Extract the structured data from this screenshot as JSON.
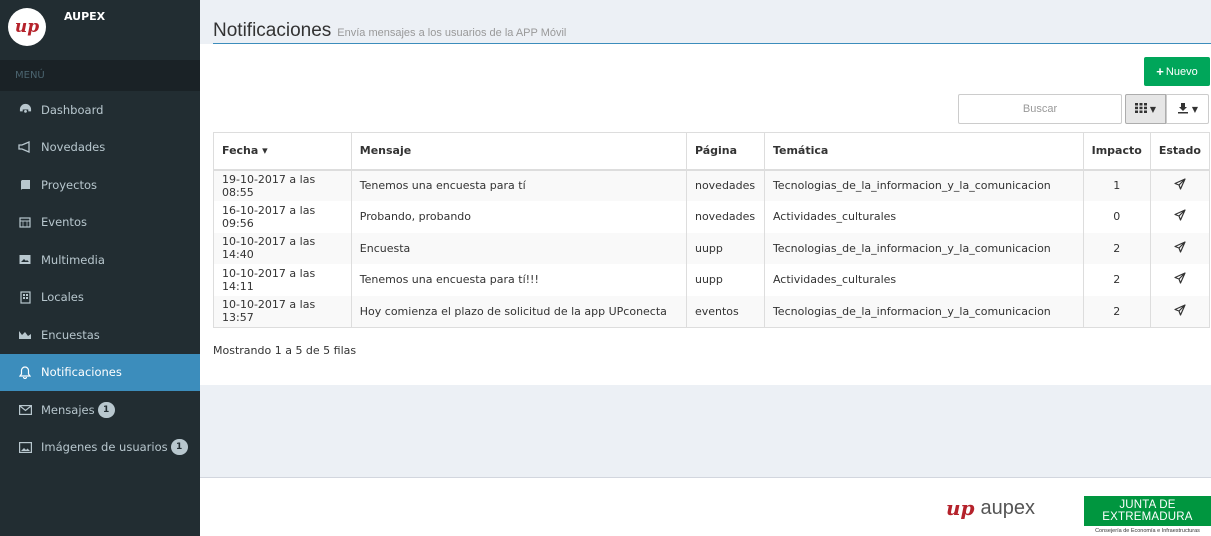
{
  "sidebar": {
    "brand": "AUPEX",
    "logo_text": "up",
    "menu_header": "MENÚ",
    "items": [
      {
        "label": "Dashboard",
        "icon": "dashboard-icon"
      },
      {
        "label": "Novedades",
        "icon": "bullhorn-icon"
      },
      {
        "label": "Proyectos",
        "icon": "book-icon"
      },
      {
        "label": "Eventos",
        "icon": "calendar-icon"
      },
      {
        "label": "Multimedia",
        "icon": "photo-icon"
      },
      {
        "label": "Locales",
        "icon": "building-icon"
      },
      {
        "label": "Encuestas",
        "icon": "chart-icon"
      },
      {
        "label": "Notificaciones",
        "icon": "bell-icon",
        "active": true
      },
      {
        "label": "Mensajes",
        "icon": "envelope-icon",
        "badge": "1"
      },
      {
        "label": "Imágenes de usuarios",
        "icon": "image-icon",
        "badge": "1"
      }
    ]
  },
  "header": {
    "title": "Notificaciones",
    "subtitle": "Envía mensajes a los usuarios de la APP Móvil"
  },
  "toolbar": {
    "new_label": "Nuevo",
    "search_placeholder": "Buscar"
  },
  "table": {
    "columns": [
      "Fecha ▾",
      "Mensaje",
      "Página",
      "Temática",
      "Impacto",
      "Estado"
    ],
    "rows": [
      {
        "fecha": "19-10-2017 a las 08:55",
        "mensaje": "Tenemos una encuesta para tí",
        "pagina": "novedades",
        "tematica": "Tecnologias_de_la_informacion_y_la_comunicacion",
        "impacto": "1"
      },
      {
        "fecha": "16-10-2017 a las 09:56",
        "mensaje": "Probando, probando",
        "pagina": "novedades",
        "tematica": "Actividades_culturales",
        "impacto": "0"
      },
      {
        "fecha": "10-10-2017 a las 14:40",
        "mensaje": "Encuesta",
        "pagina": "uupp",
        "tematica": "Tecnologias_de_la_informacion_y_la_comunicacion",
        "impacto": "2"
      },
      {
        "fecha": "10-10-2017 a las 14:11",
        "mensaje": "Tenemos una encuesta para tí!!!",
        "pagina": "uupp",
        "tematica": "Actividades_culturales",
        "impacto": "2"
      },
      {
        "fecha": "10-10-2017 a las 13:57",
        "mensaje": "Hoy comienza el plazo de solicitud de la app UPconecta",
        "pagina": "eventos",
        "tematica": "Tecnologias_de_la_informacion_y_la_comunicacion",
        "impacto": "2"
      }
    ]
  },
  "pagination_info": "Mostrando 1 a 5 de 5 filas",
  "footer": {
    "aupex_mark": "up",
    "aupex_word": "aupex",
    "junta_title": "JUNTA DE EXTREMADURA",
    "junta_subtitle": "Consejería de Economía e Infraestructuras"
  },
  "colors": {
    "sidebar_bg": "#222d32",
    "active_item": "#3c8dbc",
    "new_button": "#00a65a",
    "junta_green": "#00963f"
  }
}
